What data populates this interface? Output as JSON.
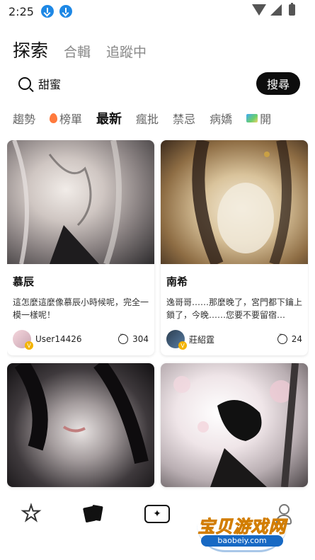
{
  "status_bar": {
    "time": "2:25"
  },
  "header": {
    "tabs": [
      {
        "label": "探索"
      },
      {
        "label": "合輯"
      },
      {
        "label": "追蹤中"
      }
    ]
  },
  "search": {
    "value": "甜蜜",
    "button_label": "搜尋"
  },
  "categories": [
    {
      "label": "趨勢"
    },
    {
      "label": "榜單",
      "icon": "fire-icon"
    },
    {
      "label": "最新"
    },
    {
      "label": "瘋批"
    },
    {
      "label": "禁忌"
    },
    {
      "label": "病嬌"
    },
    {
      "label": "開",
      "icon": "map-icon"
    }
  ],
  "cards": [
    {
      "title": "慕辰",
      "description": "這怎麼這麼像慕辰小時候呢，完全一模一樣呢！",
      "author": "User14426",
      "comments": "304",
      "badge": "V"
    },
    {
      "title": "南希",
      "description": "逸哥哥……那麼晚了，宮門都下鑰上鎖了，今晚……您要不要留宿…",
      "author": "莊紹霆",
      "comments": "24",
      "badge": "V"
    },
    {
      "title": "",
      "description": "",
      "author": "",
      "comments": ""
    },
    {
      "title": "",
      "description": "",
      "author": "",
      "comments": ""
    }
  ],
  "watermark": {
    "text": "宝贝游戏网",
    "url": "baobeiy.com"
  },
  "colors": {
    "accent": "#e8336c",
    "button": "#0d0d0d",
    "badge": "#f4b400",
    "download": "#1e88e5"
  }
}
